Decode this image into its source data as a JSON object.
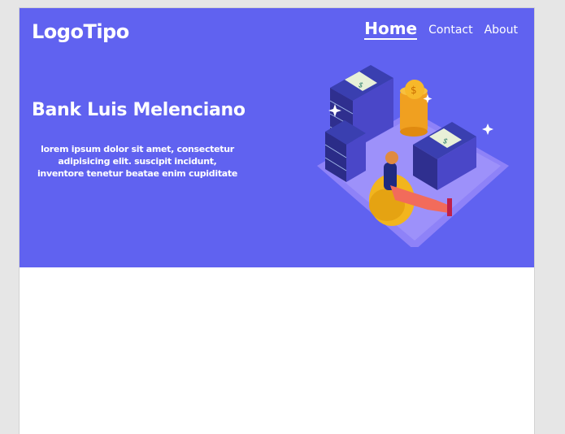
{
  "header": {
    "logo": "LogoTipo",
    "nav": [
      {
        "label": "Home",
        "active": true
      },
      {
        "label": "Contact",
        "active": false
      },
      {
        "label": "About",
        "active": false
      }
    ]
  },
  "hero": {
    "title": "Bank Luis Melenciano",
    "description": "lorem ipsum dolor sit amet, consectetur adipisicing elit. suscipit incidunt, inventore tenetur beatae enim cupiditate",
    "illustration": "person-relaxing-money-stacks-illustration"
  },
  "colors": {
    "hero_bg": "#6062f0",
    "text": "#ffffff"
  }
}
